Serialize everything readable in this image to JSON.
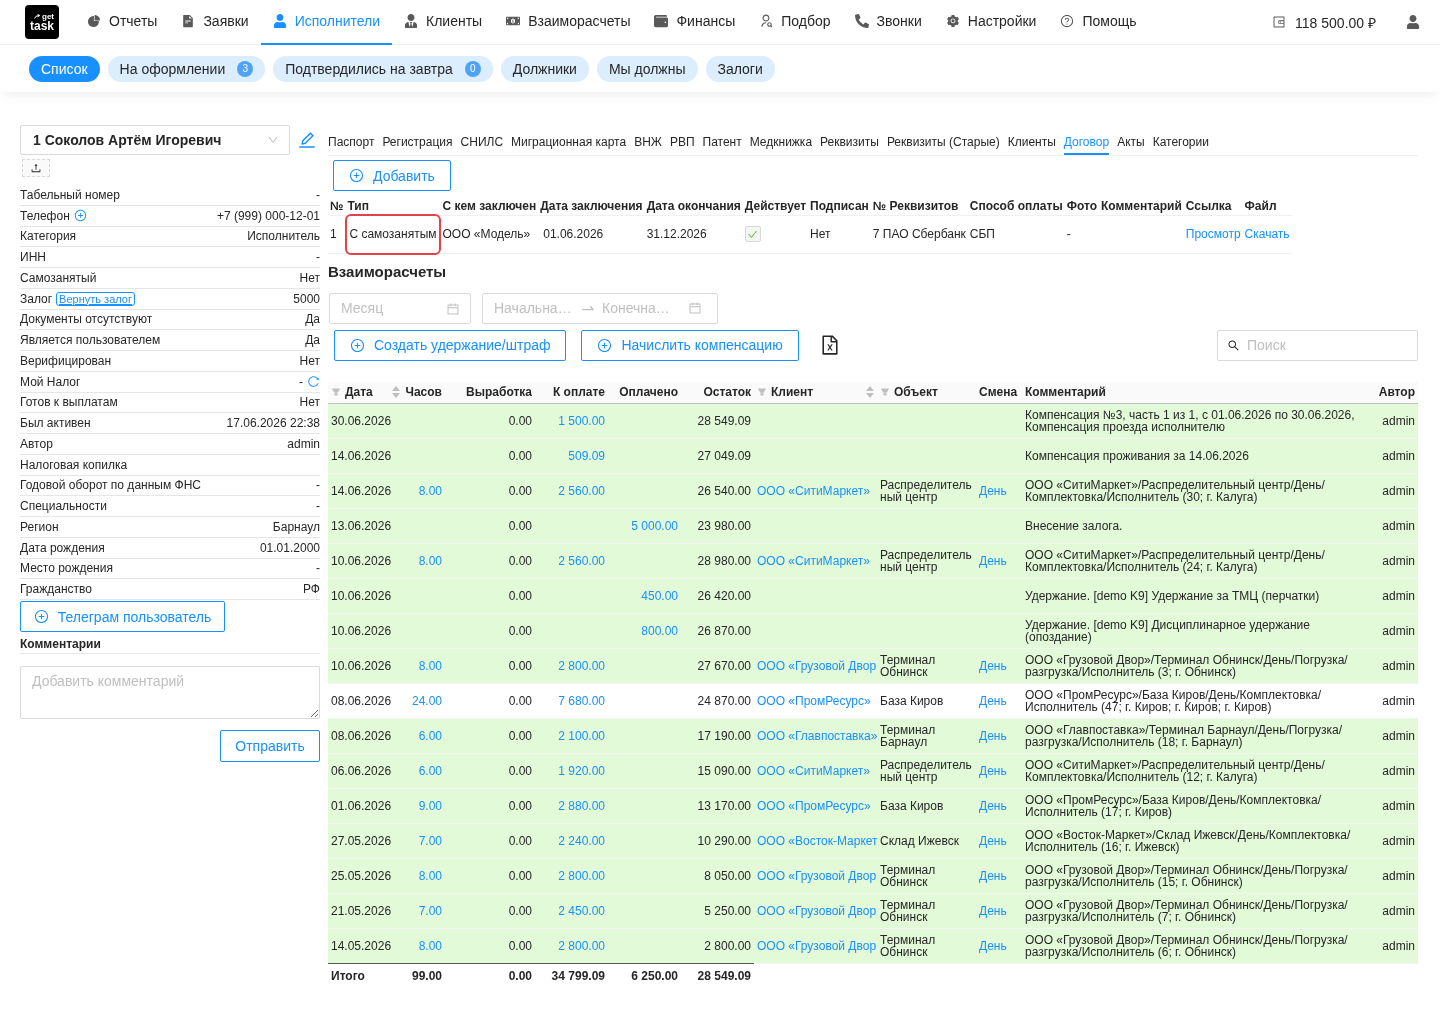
{
  "logo": {
    "top": "get",
    "bottom": "task"
  },
  "nav": {
    "items": [
      {
        "label": "Отчеты",
        "selected": false
      },
      {
        "label": "Заявки",
        "selected": false
      },
      {
        "label": "Исполнители",
        "selected": true
      },
      {
        "label": "Клиенты",
        "selected": false
      },
      {
        "label": "Взаиморасчеты",
        "selected": false
      },
      {
        "label": "Финансы",
        "selected": false
      },
      {
        "label": "Подбор",
        "selected": false
      },
      {
        "label": "Звонки",
        "selected": false
      },
      {
        "label": "Настройки",
        "selected": false
      },
      {
        "label": "Помощь",
        "selected": false
      }
    ],
    "balance": "118 500.00 ₽"
  },
  "subtabs": [
    {
      "label": "Список",
      "selected": true
    },
    {
      "label": "На оформлении",
      "badge": "3",
      "selected": false
    },
    {
      "label": "Подтвердились на завтра",
      "badge": "0",
      "selected": false
    },
    {
      "label": "Должники",
      "selected": false
    },
    {
      "label": "Мы должны",
      "selected": false
    },
    {
      "label": "Залоги",
      "selected": false
    }
  ],
  "profile": {
    "employee": "1 Соколов Артём Игоревич",
    "fields": [
      {
        "label": "Табельный номер",
        "value": "-",
        "kind": "text"
      },
      {
        "label": "Телефон",
        "value": "+7 (999) 000-12-01",
        "kind": "add"
      },
      {
        "label": "Категория",
        "value": "Исполнитель",
        "kind": "text"
      },
      {
        "label": "ИНН",
        "value": "-",
        "kind": "text"
      },
      {
        "label": "Самозанятый",
        "value": "Нет",
        "kind": "text"
      },
      {
        "label": "Залог",
        "action": "Вернуть залог",
        "value": "5000",
        "kind": "action"
      },
      {
        "label": "Документы отсутствуют",
        "value": "Да",
        "kind": "text"
      },
      {
        "label": "Является пользователем",
        "value": "Да",
        "kind": "text"
      },
      {
        "label": "Верифицирован",
        "value": "Нет",
        "kind": "text"
      },
      {
        "label": "Мой Налог",
        "value": "-",
        "kind": "refresh"
      },
      {
        "label": "Готов к выплатам",
        "value": "Нет",
        "kind": "text"
      },
      {
        "label": "Был активен",
        "value": "17.06.2026 22:38",
        "kind": "text"
      },
      {
        "label": "Автор",
        "value": "admin",
        "kind": "text"
      },
      {
        "label": "Налоговая копилка",
        "kind": "text"
      },
      {
        "label": "Годовой оборот по данным ФНС",
        "value": "-",
        "kind": "text"
      },
      {
        "label": "Специальности",
        "value": "-",
        "kind": "text"
      },
      {
        "label": "Регион",
        "value": "Барнаул",
        "kind": "text"
      },
      {
        "label": "Дата рождения",
        "value": "01.01.2000",
        "kind": "text"
      },
      {
        "label": "Место рождения",
        "value": "-",
        "kind": "text"
      },
      {
        "label": "Гражданство",
        "value": "РФ",
        "kind": "text"
      }
    ],
    "telegram_button": "Телеграм пользователь",
    "comments_title": "Комментарии",
    "comment_placeholder": "Добавить комментарий",
    "send_button": "Отправить"
  },
  "doc_tabs": [
    {
      "label": "Паспорт",
      "selected": false
    },
    {
      "label": "Регистрация",
      "selected": false
    },
    {
      "label": "СНИЛС",
      "selected": false
    },
    {
      "label": "Миграционная карта",
      "selected": false
    },
    {
      "label": "ВНЖ",
      "selected": false
    },
    {
      "label": "РВП",
      "selected": false
    },
    {
      "label": "Патент",
      "selected": false
    },
    {
      "label": "Медкнижка",
      "selected": false
    },
    {
      "label": "Реквизиты",
      "selected": false
    },
    {
      "label": "Реквизиты (Старые)",
      "selected": false
    },
    {
      "label": "Клиенты",
      "selected": false
    },
    {
      "label": "Договор",
      "selected": true
    },
    {
      "label": "Акты",
      "selected": false
    },
    {
      "label": "Категории",
      "selected": false
    }
  ],
  "contracts": {
    "add_button": "Добавить",
    "columns": [
      "№",
      "Тип",
      "С кем заключен",
      "Дата заключения",
      "Дата окончания",
      "Действует",
      "Подписан",
      "№ Реквизитов",
      "Способ оплаты",
      "Фото",
      "Комментарий",
      "Ссылка",
      "Файл"
    ],
    "rows": [
      {
        "number": "1",
        "type": "С самозанятым",
        "outlined": true,
        "counterparty": "ООО «Модель»",
        "start": "01.06.2026",
        "end": "31.12.2026",
        "active": true,
        "signed": "Нет",
        "requisites": "7 ПАО Сбербанк",
        "payment": "СБП",
        "photo": "-",
        "link": "Просмотр",
        "file": "Скачать"
      }
    ]
  },
  "settlements": {
    "title": "Взаиморасчеты",
    "month_placeholder": "Месяц",
    "start_placeholder": "Начальна…",
    "end_placeholder": "Конечна…",
    "buttons": [
      "Создать удержание/штраф",
      "Начислить компенсацию"
    ],
    "search_placeholder": "Поиск",
    "columns": [
      {
        "label": "Дата",
        "filterable": true,
        "sortable": true
      },
      {
        "label": "Часов",
        "filterable": false,
        "sortable": false
      },
      {
        "label": "Выработка",
        "filterable": false,
        "sortable": false
      },
      {
        "label": "К оплате",
        "filterable": false,
        "sortable": false
      },
      {
        "label": "Оплачено",
        "filterable": false,
        "sortable": false
      },
      {
        "label": "Остаток",
        "filterable": false,
        "sortable": false
      },
      {
        "label": "Клиент",
        "filterable": true,
        "sortable": true
      },
      {
        "label": "Объект",
        "filterable": true,
        "sortable": false
      },
      {
        "label": "Смена",
        "filterable": false,
        "sortable": false
      },
      {
        "label": "Комментарий",
        "filterable": false,
        "sortable": false
      },
      {
        "label": "Автор",
        "filterable": false,
        "sortable": false
      }
    ],
    "rows": [
      {
        "date": "30.06.2026",
        "output": "0.00",
        "to_pay": "1 500.00",
        "balance": "28 549.09",
        "comment": "Компенсация №3, часть 1 из 1, с 01.06.2026 по 30.06.2026, Компенсация проезда исполнителю",
        "author": "admin",
        "highlighted": true
      },
      {
        "date": "14.06.2026",
        "output": "0.00",
        "to_pay": "509.09",
        "balance": "27 049.09",
        "comment": "Компенсация проживания за 14.06.2026",
        "author": "admin",
        "highlighted": true
      },
      {
        "date": "14.06.2026",
        "hours": "8.00",
        "output": "0.00",
        "to_pay": "2 560.00",
        "balance": "26 540.00",
        "client": "ООО «СитиМаркет»",
        "object": "Распределительный центр",
        "shift": "День",
        "comment": "ООО «СитиМаркет»/Распределительный центр/День/Комплектовка/Исполнитель (30; г. Калуга)",
        "author": "admin",
        "highlighted": true
      },
      {
        "date": "13.06.2026",
        "output": "0.00",
        "paid": "5 000.00",
        "balance": "23 980.00",
        "comment": "Внесение залога.",
        "author": "admin",
        "highlighted": true
      },
      {
        "date": "10.06.2026",
        "hours": "8.00",
        "output": "0.00",
        "to_pay": "2 560.00",
        "balance": "28 980.00",
        "client": "ООО «СитиМаркет»",
        "object": "Распределительный центр",
        "shift": "День",
        "comment": "ООО «СитиМаркет»/Распределительный центр/День/Комплектовка/Исполнитель (24; г. Калуга)",
        "author": "admin",
        "highlighted": true
      },
      {
        "date": "10.06.2026",
        "output": "0.00",
        "paid": "450.00",
        "balance": "26 420.00",
        "comment": "Удержание. [demo K9] Удержание за ТМЦ (перчатки)",
        "author": "admin",
        "highlighted": true
      },
      {
        "date": "10.06.2026",
        "output": "0.00",
        "paid": "800.00",
        "balance": "26 870.00",
        "comment": "Удержание. [demo K9] Дисциплинарное удержание (опоздание)",
        "author": "admin",
        "highlighted": true
      },
      {
        "date": "10.06.2026",
        "hours": "8.00",
        "output": "0.00",
        "to_pay": "2 800.00",
        "balance": "27 670.00",
        "client": "ООО «Грузовой Двор",
        "object": "Терминал Обнинск",
        "shift": "День",
        "comment": "ООО «Грузовой Двор»/Терминал Обнинск/День/Погрузка/разгрузка/Исполнитель (3; г. Обнинск)",
        "author": "admin",
        "highlighted": true
      },
      {
        "date": "08.06.2026",
        "hours": "24.00",
        "output": "0.00",
        "to_pay": "7 680.00",
        "balance": "24 870.00",
        "client": "ООО «ПромРесурс»",
        "object": "База Киров",
        "shift": "День",
        "comment": "ООО «ПромРесурс»/База Киров/День/Комплектовка/Исполнитель (47; г. Киров; г. Киров; г. Киров)",
        "author": "admin",
        "highlighted": false
      },
      {
        "date": "08.06.2026",
        "hours": "6.00",
        "output": "0.00",
        "to_pay": "2 100.00",
        "balance": "17 190.00",
        "client": "ООО «Главпоставка»",
        "object": "Терминал Барнаул",
        "shift": "День",
        "comment": "ООО «Главпоставка»/Терминал Барнаул/День/Погрузка/разгрузка/Исполнитель (18; г. Барнаул)",
        "author": "admin",
        "highlighted": true
      },
      {
        "date": "06.06.2026",
        "hours": "6.00",
        "output": "0.00",
        "to_pay": "1 920.00",
        "balance": "15 090.00",
        "client": "ООО «СитиМаркет»",
        "object": "Распределительный центр",
        "shift": "День",
        "comment": "ООО «СитиМаркет»/Распределительный центр/День/Комплектовка/Исполнитель (12; г. Калуга)",
        "author": "admin",
        "highlighted": true
      },
      {
        "date": "01.06.2026",
        "hours": "9.00",
        "output": "0.00",
        "to_pay": "2 880.00",
        "balance": "13 170.00",
        "client": "ООО «ПромРесурс»",
        "object": "База Киров",
        "shift": "День",
        "comment": "ООО «ПромРесурс»/База Киров/День/Комплектовка/Исполнитель (17; г. Киров)",
        "author": "admin",
        "highlighted": true
      },
      {
        "date": "27.05.2026",
        "hours": "7.00",
        "output": "0.00",
        "to_pay": "2 240.00",
        "balance": "10 290.00",
        "client": "ООО «Восток-Маркет",
        "object": "Склад Ижевск",
        "shift": "День",
        "comment": "ООО «Восток-Маркет»/Склад Ижевск/День/Комплектовка/Исполнитель (16; г. Ижевск)",
        "author": "admin",
        "highlighted": true
      },
      {
        "date": "25.05.2026",
        "hours": "8.00",
        "output": "0.00",
        "to_pay": "2 800.00",
        "balance": "8 050.00",
        "client": "ООО «Грузовой Двор",
        "object": "Терминал Обнинск",
        "shift": "День",
        "comment": "ООО «Грузовой Двор»/Терминал Обнинск/День/Погрузка/разгрузка/Исполнитель (15; г. Обнинск)",
        "author": "admin",
        "highlighted": true
      },
      {
        "date": "21.05.2026",
        "hours": "7.00",
        "output": "0.00",
        "to_pay": "2 450.00",
        "balance": "5 250.00",
        "client": "ООО «Грузовой Двор",
        "object": "Терминал Обнинск",
        "shift": "День",
        "comment": "ООО «Грузовой Двор»/Терминал Обнинск/День/Погрузка/разгрузка/Исполнитель (7; г. Обнинск)",
        "author": "admin",
        "highlighted": true
      },
      {
        "date": "14.05.2026",
        "hours": "8.00",
        "output": "0.00",
        "to_pay": "2 800.00",
        "balance": "2 800.00",
        "client": "ООО «Грузовой Двор",
        "object": "Терминал Обнинск",
        "shift": "День",
        "comment": "ООО «Грузовой Двор»/Терминал Обнинск/День/Погрузка/разгрузка/Исполнитель (6; г. Обнинск)",
        "author": "admin",
        "highlighted": true
      }
    ],
    "totals": {
      "label": "Итого",
      "hours": "99.00",
      "output": "0.00",
      "to_pay": "34 799.09",
      "paid": "6 250.00",
      "balance": "28 549.09"
    }
  }
}
